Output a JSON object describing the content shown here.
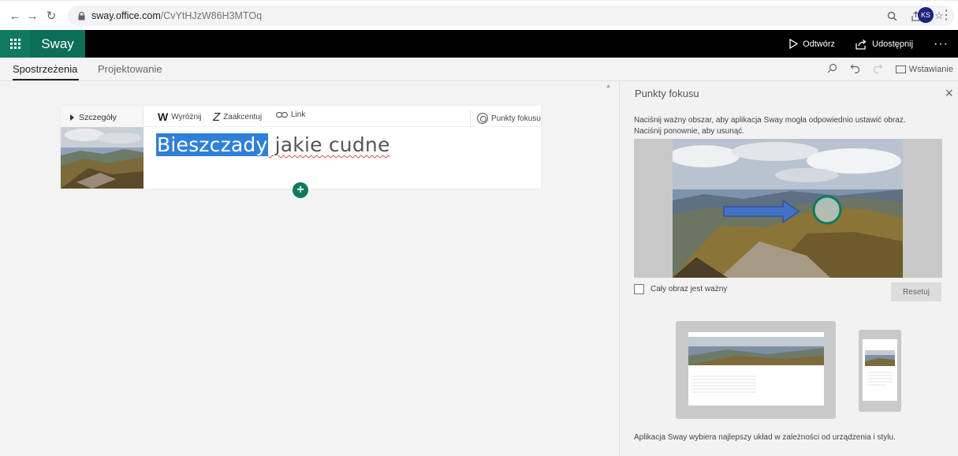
{
  "browser": {
    "url_host": "sway.office.com",
    "url_path": "/CvYtHJzW86H3MTOq",
    "profile_initials": "KS"
  },
  "appbar": {
    "brand": "Sway",
    "play_label": "Odtwórz",
    "share_label": "Udostępnij",
    "more": "···"
  },
  "tabs": {
    "insights": "Spostrzeżenia",
    "design": "Projektowanie",
    "insert": "Wstawianie"
  },
  "card": {
    "details_label": "Szczegóły",
    "emphasize_glyph": "W",
    "emphasize_label": "Wyróżnij",
    "accent_glyph": "Z",
    "accent_label": "Zaakcentuj",
    "link_label": "Link",
    "focus_label": "Punkty fokusu",
    "title_highlight": "Bieszczady",
    "title_rest": " jakie cudne",
    "add_glyph": "+"
  },
  "pane": {
    "title": "Punkty fokusu",
    "close": "×",
    "description": "Naciśnij ważny obszar, aby aplikacja Sway mogła odpowiednio ustawić obraz. Naciśnij ponownie, aby usunąć.",
    "checkbox_label": "Cały obraz jest ważny",
    "reset_label": "Resetuj",
    "footer": "Aplikacja Sway wybiera najlepszy układ w zależności od urządzenia i stylu."
  },
  "colors": {
    "brand_green": "#0b6e58",
    "highlight_blue": "#2f80d8",
    "add_green": "#0d7a5f"
  },
  "icons": [
    "back-icon",
    "forward-icon",
    "reload-icon",
    "lock-icon",
    "zoom-icon",
    "share-page-icon",
    "bookmark-star-icon",
    "app-launcher-icon",
    "play-icon",
    "share-icon",
    "search-icon",
    "undo-icon",
    "redo-icon",
    "insert-icon",
    "focus-points-icon",
    "link-icon",
    "close-icon",
    "add-icon"
  ]
}
